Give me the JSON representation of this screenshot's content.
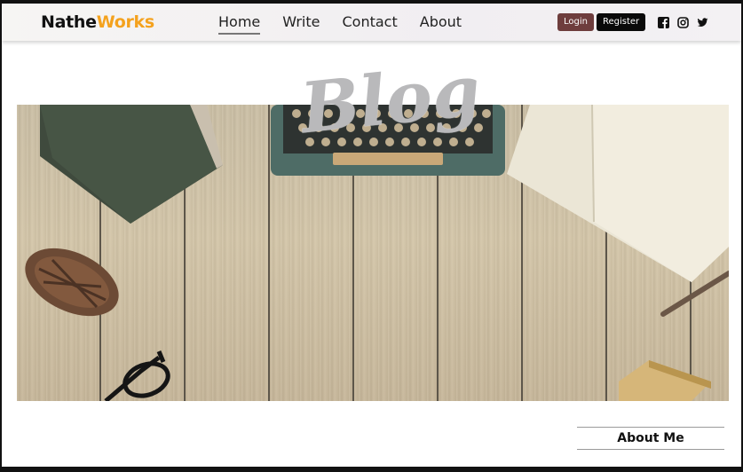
{
  "brand": {
    "part1": "Nathe",
    "part2": "Works",
    "accent_color": "#f4a21e"
  },
  "nav": {
    "items": [
      {
        "label": "Home",
        "active": true
      },
      {
        "label": "Write",
        "active": false
      },
      {
        "label": "Contact",
        "active": false
      },
      {
        "label": "About",
        "active": false
      }
    ]
  },
  "auth": {
    "login_label": "Login",
    "register_label": "Register",
    "login_color": "#6e3d3d",
    "register_color": "#0a0a0a"
  },
  "social": {
    "icons": [
      "facebook-icon",
      "instagram-icon",
      "twitter-icon"
    ]
  },
  "hero": {
    "title": "Blog"
  },
  "sidebar": {
    "about_title": "About Me"
  }
}
